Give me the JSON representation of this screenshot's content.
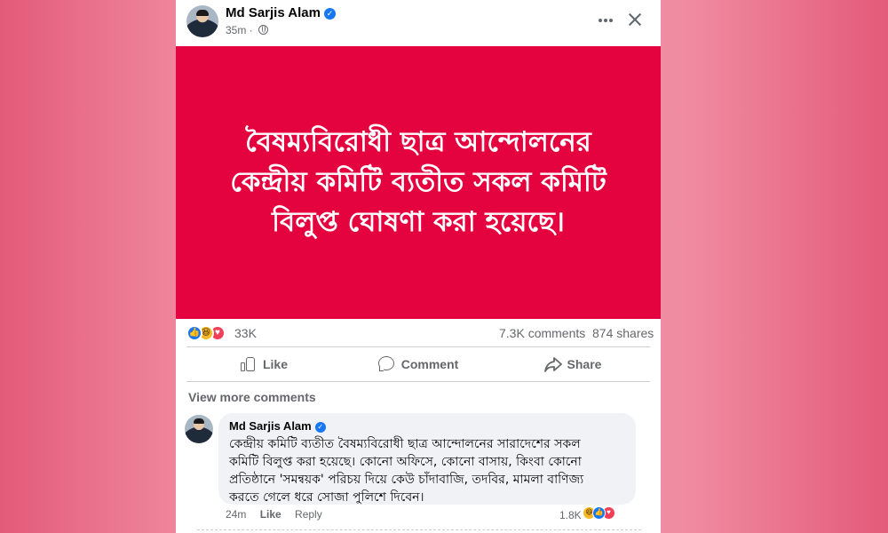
{
  "post": {
    "author": "Md Sarjis Alam",
    "time": "35m",
    "image_text": [
      "বৈষম্যবিরোধী ছাত্র আন্দোলনের",
      "কেন্দ্রীয় কমিটি ব্যতীত সকল কমিটি",
      "বিলুপ্ত ঘোষণা করা হয়েছে।"
    ],
    "colors": {
      "image_background": "#e5033f",
      "accent": "#1877f2"
    }
  },
  "stats": {
    "reactions_count": "33K",
    "comments": "7.3K comments",
    "shares": "874 shares",
    "reaction_icons": [
      "like-icon",
      "haha-icon",
      "love-icon"
    ]
  },
  "actions": {
    "like": "Like",
    "comment": "Comment",
    "share": "Share"
  },
  "view_more_comments": "View more comments",
  "comment": {
    "author": "Md Sarjis Alam",
    "text": "কেন্দ্রীয় কমিটি ব্যতীত বৈষম্যবিরোধী ছাত্র আন্দোলনের সারাদেশের সকল\nকমিটি বিলুপ্ত করা হয়েছে। কোনো অফিসে, কোনো বাসায়, কিংবা কোনো\nপ্রতিষ্ঠানে 'সমন্বয়ক' পরিচয় দিয়ে কেউ চাঁদাবাজি, তদবির, মামলা বাণিজ্য\nকরতে গেলে ধরে সোজা পুলিশে দিবেন।",
    "time": "24m",
    "like_label": "Like",
    "reply_label": "Reply",
    "reactions_count": "1.8K",
    "reaction_icons": [
      "haha-icon",
      "like-icon",
      "love-icon"
    ]
  }
}
